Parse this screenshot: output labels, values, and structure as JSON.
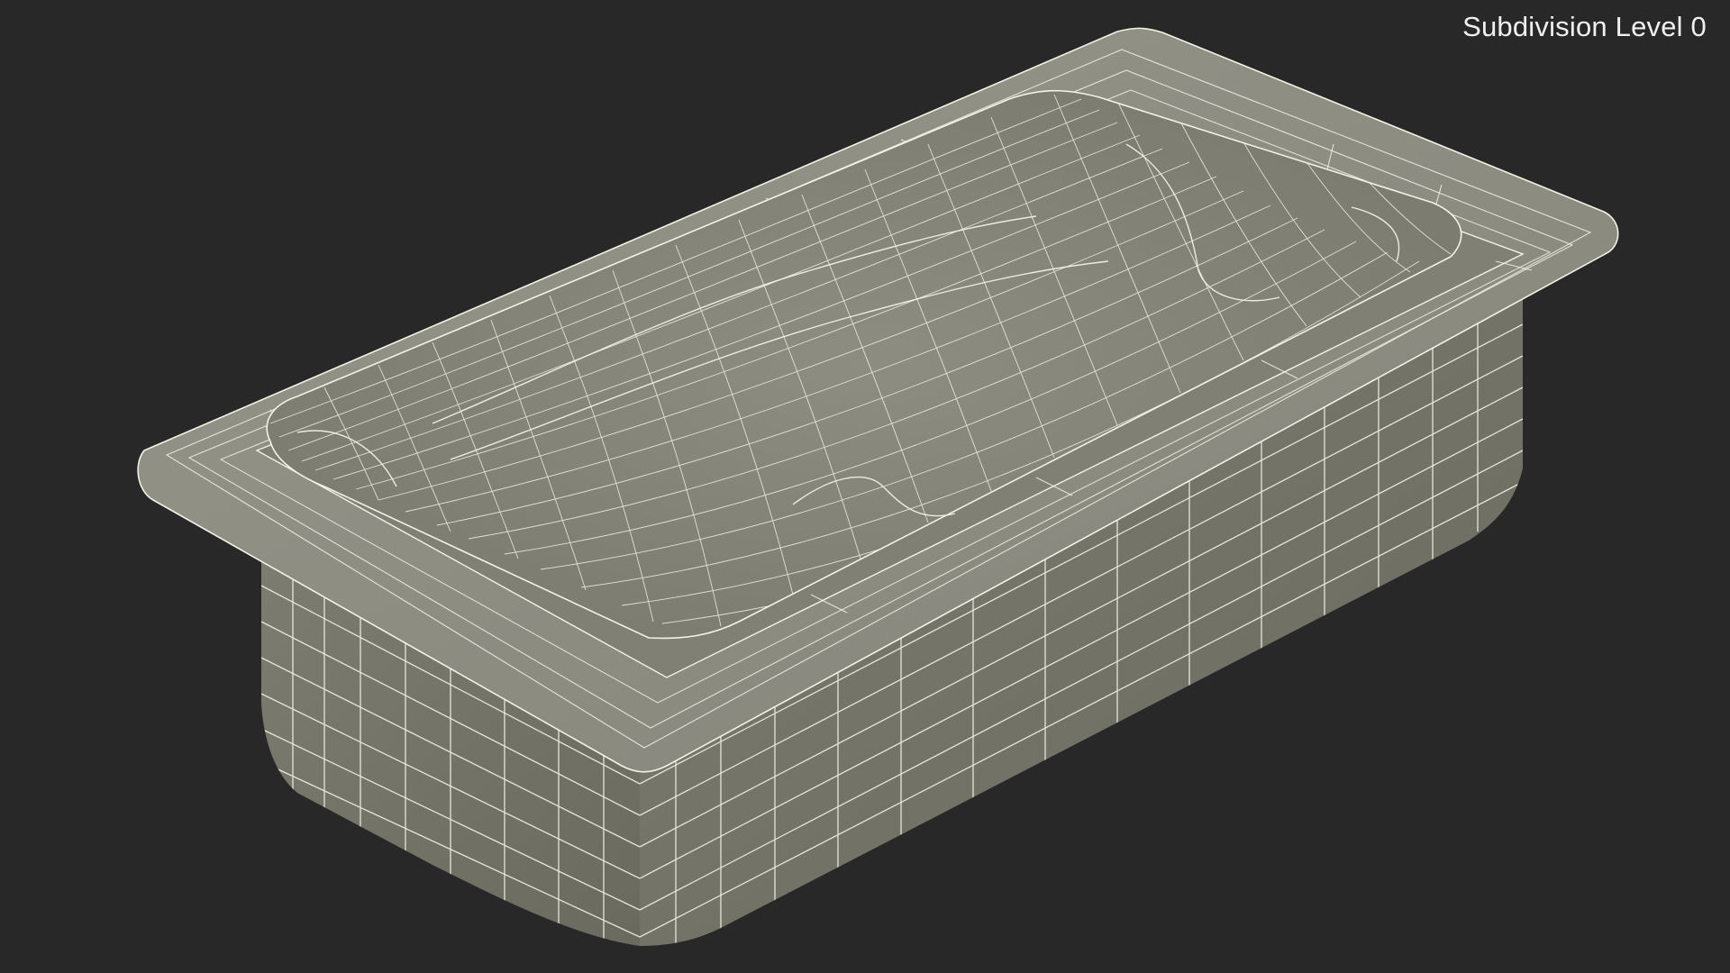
{
  "viewport": {
    "subdivision_label": "Subdivision Level 0",
    "background_color": "#282828",
    "mesh_fill_color": "#8a8a7d",
    "wire_color": "#f2f2e6"
  },
  "model": {
    "icon": "bathtub-wireframe-icon"
  }
}
